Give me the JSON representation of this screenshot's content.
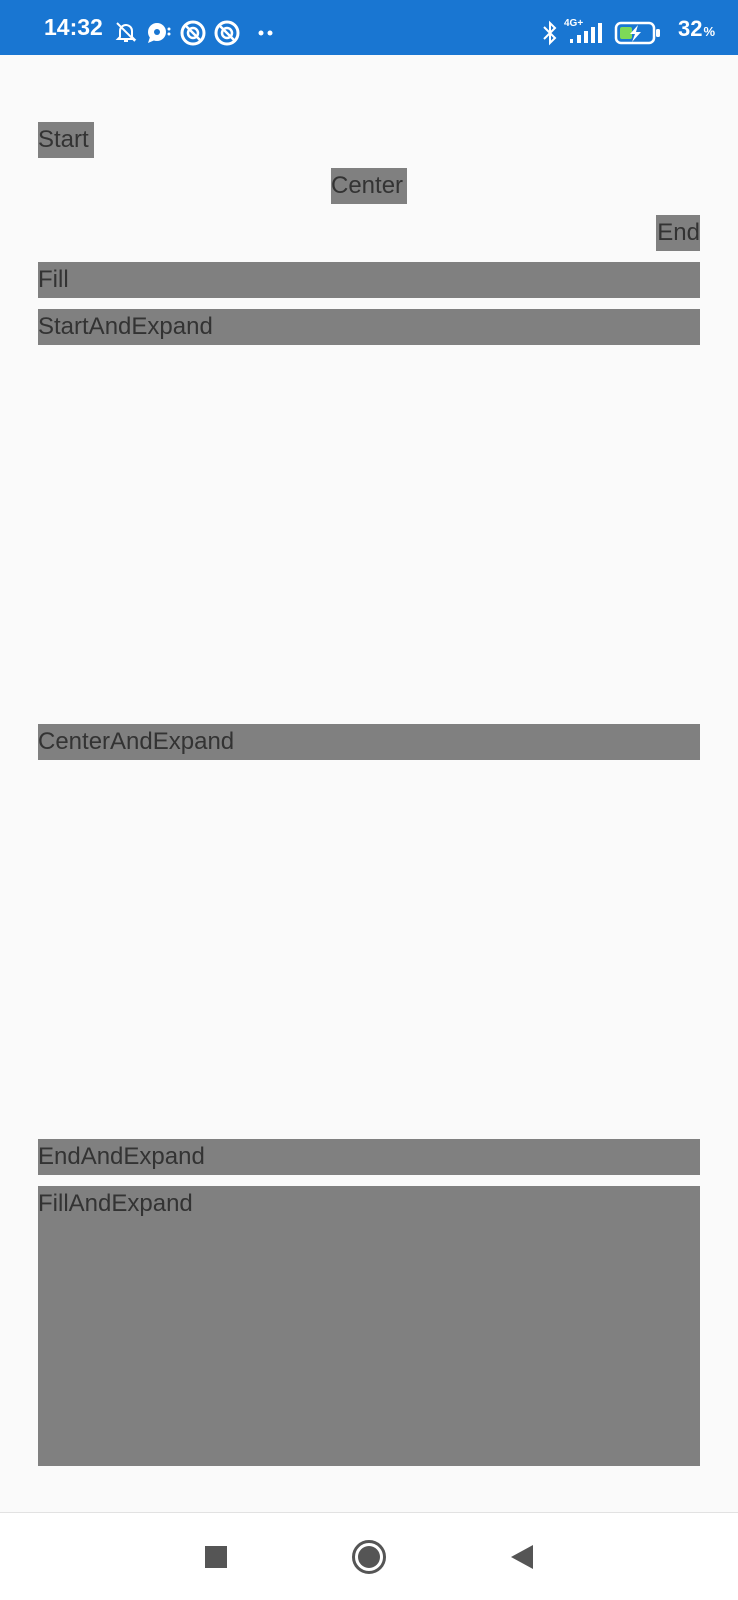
{
  "status_bar": {
    "time": "14:32",
    "battery_percent": "32",
    "battery_unit": "%",
    "network_label": "4G+",
    "icons": [
      "bell-off-icon",
      "chat-bubble-icon",
      "no-disturb-icon",
      "no-disturb-icon",
      "more-dots-icon",
      "bluetooth-icon",
      "signal-icon",
      "battery-charging-icon"
    ],
    "colors": {
      "background": "#1976d2",
      "foreground": "#ffffff"
    }
  },
  "labels": {
    "start": "Start",
    "center": "Center",
    "end": "End",
    "fill": "Fill",
    "start_and_expand": "StartAndExpand",
    "center_and_expand": "CenterAndExpand",
    "end_and_expand": "EndAndExpand",
    "fill_and_expand": "FillAndExpand"
  },
  "colors": {
    "page_background": "#fafafa",
    "label_background": "#808080",
    "label_text": "#333333"
  },
  "nav_bar": {
    "buttons": [
      "recents-icon",
      "home-icon",
      "back-icon"
    ]
  }
}
